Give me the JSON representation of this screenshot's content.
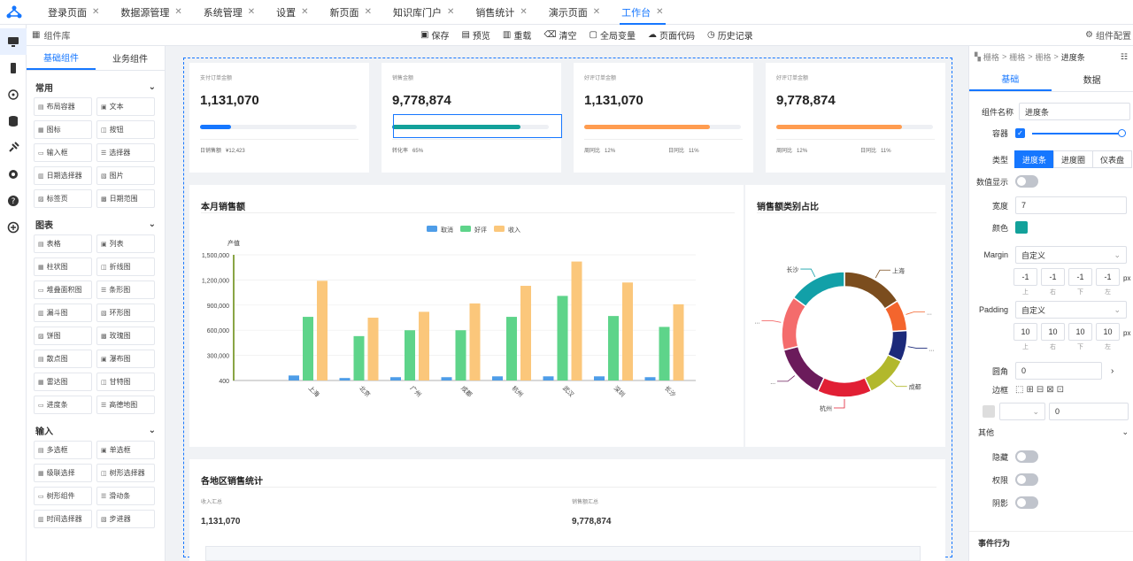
{
  "tabs": [
    {
      "label": "登录页面"
    },
    {
      "label": "数据源管理"
    },
    {
      "label": "系统管理"
    },
    {
      "label": "设置"
    },
    {
      "label": "新页面"
    },
    {
      "label": "知识库门户"
    },
    {
      "label": "销售统计"
    },
    {
      "label": "演示页面"
    },
    {
      "label": "工作台",
      "active": true
    }
  ],
  "toolbar": {
    "library": "组件库",
    "save": "保存",
    "preview": "预览",
    "reload": "重载",
    "clear": "清空",
    "global_vars": "全局变量",
    "page_code": "页面代码",
    "history": "历史记录",
    "config": "组件配置"
  },
  "left": {
    "tab_basic": "基础组件",
    "tab_business": "业务组件",
    "sections": [
      {
        "title": "常用",
        "items": [
          "布局容器",
          "文本",
          "图标",
          "按钮",
          "输入框",
          "选择器",
          "日期选择器",
          "图片",
          "标签页",
          "日期范围"
        ]
      },
      {
        "title": "图表",
        "items": [
          "表格",
          "列表",
          "柱状图",
          "折线图",
          "堆叠面积图",
          "条形图",
          "漏斗图",
          "环形图",
          "饼图",
          "玫瑰图",
          "散点图",
          "瀑布图",
          "雷达图",
          "甘特图",
          "进度条",
          "高德地图"
        ]
      },
      {
        "title": "输入",
        "items": [
          "多选框",
          "单选框",
          "级联选择",
          "树形选择器",
          "树形组件",
          "滑动条",
          "时间选择器",
          "步进器"
        ]
      }
    ]
  },
  "kpis": [
    {
      "label": "支付订单金额",
      "value": "1,131,070",
      "progress": 0.2,
      "color": "#1677ff",
      "foot": [
        {
          "k": "日销售额",
          "v": "¥12,423"
        }
      ]
    },
    {
      "label": "销售金额",
      "value": "9,778,874",
      "progress": 0.82,
      "color": "#13a19a",
      "foot": [
        {
          "k": "转化率",
          "v": "65%"
        }
      ]
    },
    {
      "label": "好评订单金额",
      "value": "1,131,070",
      "progress": 0.8,
      "color": "#ff9c50",
      "foot": [
        {
          "k": "周同比",
          "v": "12%"
        },
        {
          "k": "日同比",
          "v": "11%"
        }
      ]
    },
    {
      "label": "好评订单金额",
      "value": "9,778,874",
      "progress": 0.8,
      "color": "#ff9c50",
      "foot": [
        {
          "k": "周同比",
          "v": "12%"
        },
        {
          "k": "日同比",
          "v": "11%"
        }
      ]
    }
  ],
  "bar_title": "本月销售额",
  "pie_title": "销售额类别占比",
  "chart_data": [
    {
      "type": "bar",
      "title": "本月销售额",
      "ylabel": "产值",
      "ylim": [
        400,
        1500000
      ],
      "yticks": [
        "1,500,000",
        "1,200,000",
        "900,000",
        "600,000",
        "300,000",
        "400"
      ],
      "categories": [
        "上海",
        "北京",
        "广州",
        "成都",
        "杭州",
        "武汉",
        "深圳",
        "长沙"
      ],
      "series": [
        {
          "name": "取消",
          "color": "#4e9de8",
          "values": [
            60000,
            30000,
            40000,
            40000,
            50000,
            50000,
            50000,
            40000
          ]
        },
        {
          "name": "好评",
          "color": "#5ed48a",
          "values": [
            760000,
            530000,
            600000,
            600000,
            760000,
            1010000,
            770000,
            640000
          ]
        },
        {
          "name": "收入",
          "color": "#fbc77b",
          "values": [
            1190000,
            750000,
            820000,
            920000,
            1130000,
            1420000,
            1170000,
            910000
          ]
        }
      ],
      "legend": "top-center",
      "grid": true
    },
    {
      "type": "pie",
      "title": "销售额类别占比",
      "donut": true,
      "slices": [
        {
          "label": "上海",
          "value": 16,
          "color": "#7b4d1e"
        },
        {
          "label": "...",
          "value": 8,
          "color": "#f4652d"
        },
        {
          "label": "...",
          "value": 8,
          "color": "#1c2a7a"
        },
        {
          "label": "成都",
          "value": 11,
          "color": "#b2b82c"
        },
        {
          "label": "杭州",
          "value": 14,
          "color": "#e11f34"
        },
        {
          "label": "...",
          "value": 14,
          "color": "#6b1b5b"
        },
        {
          "label": "...",
          "value": 14,
          "color": "#f46c6c"
        },
        {
          "label": "长沙",
          "value": 15,
          "color": "#12a0a8"
        }
      ]
    }
  ],
  "region": {
    "title": "各地区销售统计",
    "k1": "收入汇总",
    "v1": "1,131,070",
    "k2": "销售额汇总",
    "v2": "9,778,874"
  },
  "right": {
    "crumbs": [
      "栅格",
      "栅格",
      "栅格",
      "进度条"
    ],
    "tab_basic": "基础",
    "tab_data": "数据",
    "name_label": "组件名称",
    "name_value": "进度条",
    "container_label": "容器",
    "type_label": "类型",
    "types": [
      "进度条",
      "进度圈",
      "仪表盘"
    ],
    "value_display": "数值显示",
    "width_label": "宽度",
    "width_value": "7",
    "color_label": "颜色",
    "color_value": "#13a19a",
    "margin_label": "Margin",
    "margin_mode": "自定义",
    "margin_values": [
      "-1",
      "-1",
      "-1",
      "-1"
    ],
    "sides": [
      "上",
      "右",
      "下",
      "左"
    ],
    "unit": "px",
    "padding_label": "Padding",
    "padding_mode": "自定义",
    "padding_values": [
      "10",
      "10",
      "10",
      "10"
    ],
    "radius_label": "圆角",
    "radius_value": "0",
    "border_label": "边框",
    "border_value": "0",
    "other_label": "其他",
    "hide_label": "隐藏",
    "perm_label": "权限",
    "shadow_label": "阴影",
    "events_label": "事件行为"
  }
}
